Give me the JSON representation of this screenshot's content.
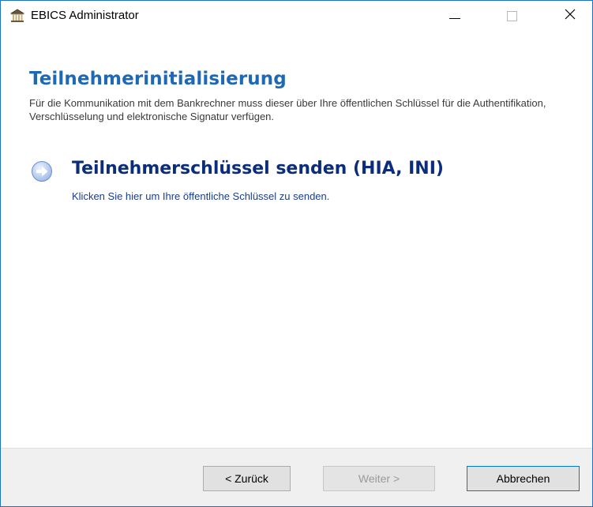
{
  "window": {
    "title": "EBICS Administrator",
    "icon": "bank-building-icon",
    "controls": {
      "minimize": "minimize-icon",
      "maximize": "maximize-icon",
      "close": "close-icon"
    }
  },
  "header": {
    "title": "Teilnehmerinitialisierung",
    "description": "Für die Kommunikation mit dem Bankrechner muss dieser über Ihre öffentlichen Schlüssel für die Authentifikation, Verschlüsselung und elektronische Signatur verfügen."
  },
  "command_link": {
    "icon": "arrow-right-circle-icon",
    "title": "Teilnehmerschlüssel senden (HIA, INI)",
    "description": "Klicken Sie hier um Ihre öffentliche Schlüssel zu senden."
  },
  "footer": {
    "back_label": "< Zurück",
    "next_label": "Weiter >",
    "cancel_label": "Abbrechen"
  },
  "colors": {
    "accent": "#1f69b4",
    "command_title": "#0c2e7a",
    "window_border": "#1a73c9"
  }
}
